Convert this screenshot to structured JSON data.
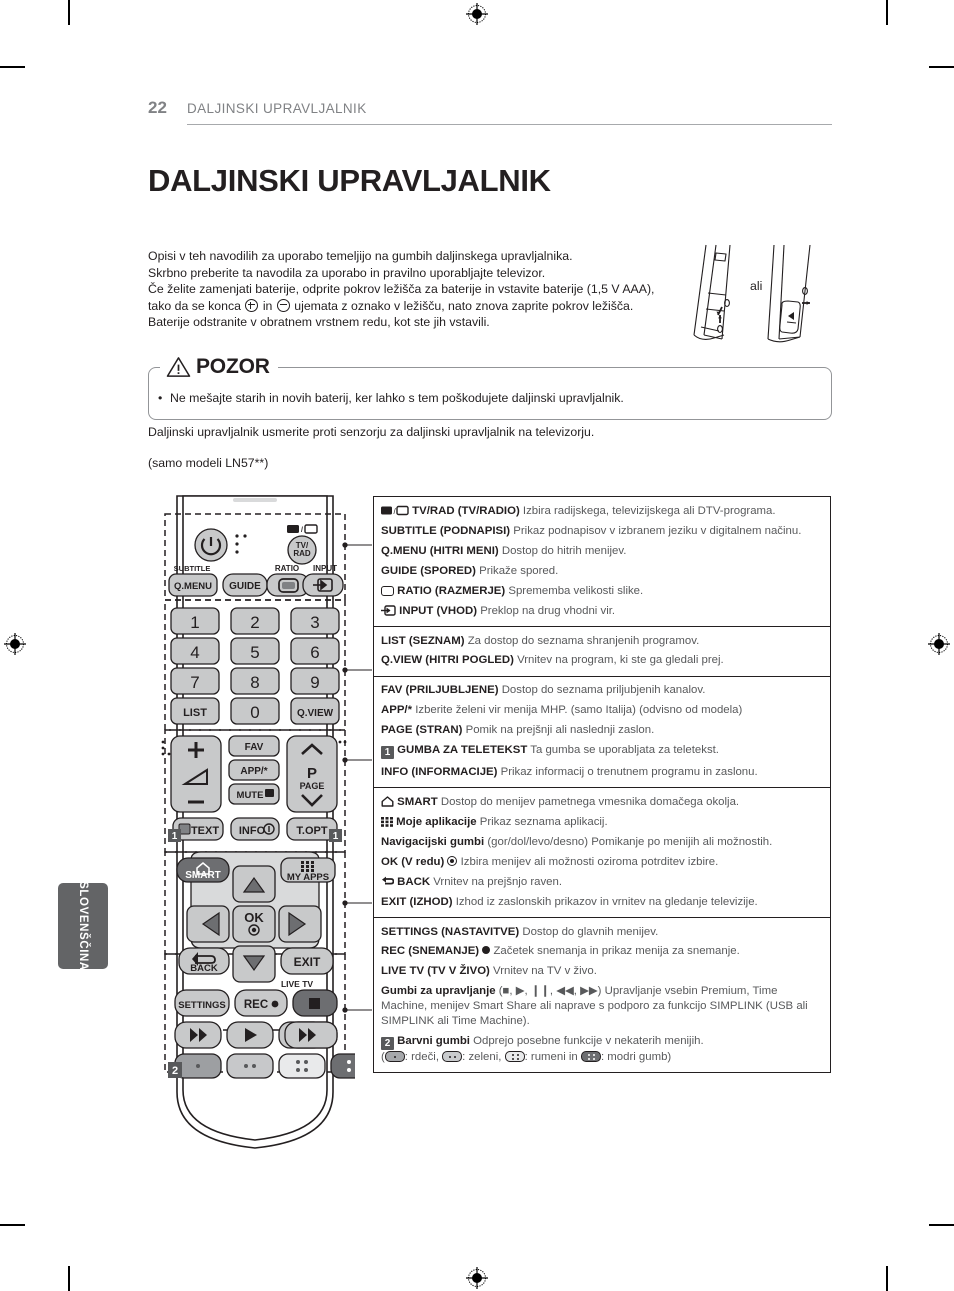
{
  "header": {
    "page_number": "22",
    "title": "DALJINSKI UPRAVLJALNIK"
  },
  "chapter_title": "DALJINSKI UPRAVLJALNIK",
  "intro": {
    "line1": "Opisi v teh navodilih za uporabo temeljijo na gumbih daljinskega upravljalnika.",
    "line2": "Skrbno preberite ta navodila za uporabo in pravilno uporabljajte televizor.",
    "line3": "Če želite zamenjati baterije, odprite pokrov ležišča za baterije in vstavite baterije (1,5 V AAA),",
    "line4_a": "tako da se konca",
    "line4_b": "in",
    "line4_c": "ujemata z oznako v ležišču, nato znova zaprite pokrov ležišča.",
    "line5": "Baterije odstranite v obratnem vrstnem redu, kot ste jih vstavili."
  },
  "battery_figure": {
    "ali_label": "ali"
  },
  "caution": {
    "heading": "POZOR",
    "bullet_symbol": "•",
    "item": "Ne mešajte starih in novih baterij, ker lahko s tem poškodujete daljinski upravljalnik."
  },
  "sensor_note": "Daljinski upravljalnik usmerite proti senzorju za daljinski upravljalnik na televizorju.",
  "model_note": "(samo modeli LN57**)",
  "language_tab": "SLOVENŠČINA",
  "remote": {
    "power_label": "",
    "tvrad": "TV/\nRAD",
    "subtitle_label": "SUBTITLE",
    "qmenu": "Q.MENU",
    "guide": "GUIDE",
    "ratio_label": "RATIO",
    "input_label": "INPUT",
    "keys": [
      "1",
      "2",
      "3",
      "4",
      "5",
      "6",
      "7",
      "8",
      "9"
    ],
    "list": "LIST",
    "zero": "0",
    "qview": "Q.VIEW",
    "fav": "FAV",
    "app": "APP/*",
    "mute": "MUTE",
    "page_p": "P",
    "page_label": "PAGE",
    "text": "TEXT",
    "info": "INFO",
    "topt": "T.OPT",
    "smart": "SMART",
    "myapps": "MY APPS",
    "ok": "OK",
    "back": "BACK",
    "exit": "EXIT",
    "livetv": "LIVE TV",
    "settings": "SETTINGS",
    "rec": "REC",
    "marker_1": "1",
    "marker_2": "2"
  },
  "desc_table": {
    "groups": [
      {
        "rows": [
          {
            "icon": "tv-radio-icon",
            "bold": "TV/RAD (TV/RADIO)",
            "text": "Izbira radijskega, televizijskega ali DTV-programa."
          },
          {
            "icon": "",
            "bold": "SUBTITLE (PODNAPISI)",
            "text": "Prikaz podnapisov v izbranem jeziku v digitalnem načinu."
          },
          {
            "icon": "",
            "bold": "Q.MENU (HITRI MENI)",
            "text": "Dostop do hitrih menijev."
          },
          {
            "icon": "",
            "bold": "GUIDE (SPORED)",
            "text": "Prikaže spored."
          },
          {
            "icon": "ratio-icon",
            "bold": "RATIO (RAZMERJE)",
            "text": "Sprememba velikosti slike."
          },
          {
            "icon": "input-icon",
            "bold": "INPUT (VHOD)",
            "text": "Preklop na drug vhodni vir."
          }
        ]
      },
      {
        "rows": [
          {
            "icon": "",
            "bold": "LIST (SEZNAM)",
            "text": "Za dostop do seznama shranjenih programov."
          },
          {
            "icon": "",
            "bold": "Q.VIEW (HITRI POGLED)",
            "text": "Vrnitev na program, ki ste ga gledali prej."
          }
        ]
      },
      {
        "rows": [
          {
            "icon": "",
            "bold": "FAV (PRILJUBLJENE)",
            "text": "Dostop do seznama priljubjenih kanalov."
          },
          {
            "icon": "",
            "bold": "APP/*",
            "text": "Izberite želeni vir menija MHP. (samo Italija) (odvisno od modela)"
          },
          {
            "icon": "",
            "bold": "PAGE (STRAN)",
            "text": "Pomik na prejšnji ali naslednji zaslon."
          },
          {
            "icon": "number-1-badge",
            "bold": "GUMBA ZA TELETEKST",
            "text": "Ta gumba se uporabljata za teletekst."
          },
          {
            "icon": "",
            "bold": "INFO (INFORMACIJE)",
            "text": "Prikaz informacij o trenutnem programu in zaslonu."
          }
        ]
      },
      {
        "rows": [
          {
            "icon": "smart-home-icon",
            "bold": "SMART",
            "text": "Dostop do menijev pametnega vmesnika domačega okolja."
          },
          {
            "icon": "my-apps-icon",
            "bold": "Moje aplikacije",
            "text": "Prikaz seznama aplikacij."
          },
          {
            "icon": "",
            "bold": "Navigacijski gumbi",
            "text": "(gor/dol/levo/desno) Pomikanje po menijih ali možnostih."
          },
          {
            "icon": "ok-dot-icon",
            "bold": "OK (V redu)",
            "text": "Izbira menijev ali možnosti oziroma potrditev izbire."
          },
          {
            "icon": "back-arrow-icon",
            "bold": "BACK",
            "text": "Vrnitev na prejšnjo raven."
          },
          {
            "icon": "",
            "bold": "EXIT (IZHOD)",
            "text": "Izhod iz zaslonskih prikazov in vrnitev na gledanje televizije."
          }
        ]
      },
      {
        "rows": [
          {
            "icon": "",
            "bold": "SETTINGS (NASTAVITVE)",
            "text": "Dostop do glavnih menijev."
          },
          {
            "icon": "",
            "bold": "REC (SNEMANJE)",
            "text": "Začetek snemanja in prikaz menija za snemanje."
          },
          {
            "icon": "",
            "bold": "LIVE TV (TV V ŽIVO)",
            "text": "Vrnitev na TV v živo."
          },
          {
            "icon": "playback-icons",
            "bold": "Gumbi za upravljanje",
            "text": "Upravljanje vsebin Premium, Time Machine, menijev Smart Share ali naprave s podporo za funkcijo SIMPLINK (USB ali SIMPLINK ali Time Machine)."
          },
          {
            "icon": "number-2-badge",
            "bold": "Barvni gumbi",
            "text": "Odprejo posebne funkcije v nekaterih menijih."
          }
        ]
      }
    ],
    "color_legend": {
      "red": ": rdeči,",
      "green": ": zeleni,",
      "yellow": ": rumeni in",
      "blue": ": modri gumb)",
      "open_paren": "(",
      "colors": {
        "red": "#a6a8ab",
        "green": "#c9cbcd",
        "yellow": "#e9eaeb",
        "blue": "#6d6e71"
      }
    },
    "playback_symbols": "(■, ▶, ❙❙, ◀◀, ▶▶)"
  },
  "theme": {
    "ink": "#231f20",
    "body_gray": "#58595b",
    "header_gray": "#808285",
    "tab_gray": "#636466"
  }
}
